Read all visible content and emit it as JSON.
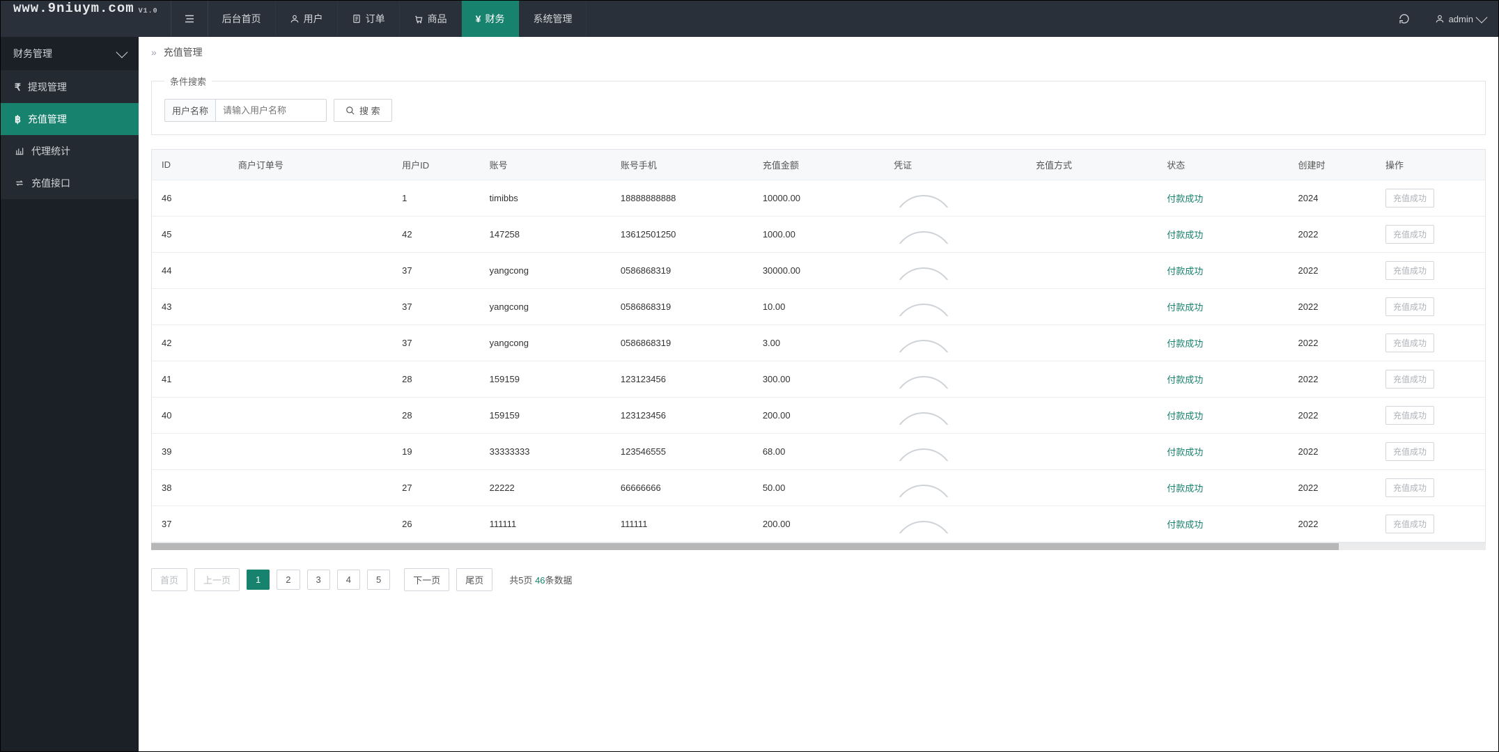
{
  "brand": {
    "url": "www.9niuym.com",
    "version": "V1.0"
  },
  "topnav": {
    "items": [
      {
        "key": "home",
        "label": "后台首页"
      },
      {
        "key": "user",
        "label": "用户"
      },
      {
        "key": "order",
        "label": "订单"
      },
      {
        "key": "product",
        "label": "商品"
      },
      {
        "key": "finance",
        "label": "财务"
      },
      {
        "key": "system",
        "label": "系统管理"
      }
    ],
    "active": "finance"
  },
  "user": {
    "name": "admin"
  },
  "sidebar": {
    "group": "财务管理",
    "items": [
      {
        "key": "withdraw",
        "label": "提现管理"
      },
      {
        "key": "recharge",
        "label": "充值管理"
      },
      {
        "key": "agent",
        "label": "代理统计"
      },
      {
        "key": "gateway",
        "label": "充值接口"
      }
    ],
    "active": "recharge"
  },
  "breadcrumb": {
    "title": "充值管理"
  },
  "search": {
    "legend": "条件搜索",
    "field_label": "用户名称",
    "placeholder": "请输入用户名称",
    "button": "搜 索"
  },
  "table": {
    "columns": {
      "id": "ID",
      "merchant_order": "商户订单号",
      "user_id": "用户ID",
      "account": "账号",
      "phone": "账号手机",
      "amount": "充值金额",
      "proof": "凭证",
      "method": "充值方式",
      "status": "状态",
      "created": "创建时",
      "op": "操作"
    },
    "status_ok_label": "付款成功",
    "op_button_label": "充值成功",
    "rows": [
      {
        "id": "46",
        "merchant_order": "",
        "user_id": "1",
        "account": "timibbs",
        "phone": "18888888888",
        "amount": "10000.00",
        "method": "",
        "status": "付款成功",
        "created": "2024"
      },
      {
        "id": "45",
        "merchant_order": "",
        "user_id": "42",
        "account": "147258",
        "phone": "13612501250",
        "amount": "1000.00",
        "method": "",
        "status": "付款成功",
        "created": "2022"
      },
      {
        "id": "44",
        "merchant_order": "",
        "user_id": "37",
        "account": "yangcong",
        "phone": "0586868319",
        "amount": "30000.00",
        "method": "",
        "status": "付款成功",
        "created": "2022"
      },
      {
        "id": "43",
        "merchant_order": "",
        "user_id": "37",
        "account": "yangcong",
        "phone": "0586868319",
        "amount": "10.00",
        "method": "",
        "status": "付款成功",
        "created": "2022"
      },
      {
        "id": "42",
        "merchant_order": "",
        "user_id": "37",
        "account": "yangcong",
        "phone": "0586868319",
        "amount": "3.00",
        "method": "",
        "status": "付款成功",
        "created": "2022"
      },
      {
        "id": "41",
        "merchant_order": "",
        "user_id": "28",
        "account": "159159",
        "phone": "123123456",
        "amount": "300.00",
        "method": "",
        "status": "付款成功",
        "created": "2022"
      },
      {
        "id": "40",
        "merchant_order": "",
        "user_id": "28",
        "account": "159159",
        "phone": "123123456",
        "amount": "200.00",
        "method": "",
        "status": "付款成功",
        "created": "2022"
      },
      {
        "id": "39",
        "merchant_order": "",
        "user_id": "19",
        "account": "33333333",
        "phone": "123546555",
        "amount": "68.00",
        "method": "",
        "status": "付款成功",
        "created": "2022"
      },
      {
        "id": "38",
        "merchant_order": "",
        "user_id": "27",
        "account": "22222",
        "phone": "66666666",
        "amount": "50.00",
        "method": "",
        "status": "付款成功",
        "created": "2022"
      },
      {
        "id": "37",
        "merchant_order": "",
        "user_id": "26",
        "account": "111111",
        "phone": "111111",
        "amount": "200.00",
        "method": "",
        "status": "付款成功",
        "created": "2022"
      }
    ]
  },
  "pagination": {
    "first": "首页",
    "prev": "上一页",
    "next": "下一页",
    "last": "尾页",
    "pages": [
      "1",
      "2",
      "3",
      "4",
      "5"
    ],
    "active": "1",
    "info_prefix": "共5页 ",
    "total": "46",
    "info_suffix": "条数据"
  },
  "icons": {
    "user": "user-icon",
    "order": "file-icon",
    "product": "cart-icon",
    "finance": "yen-icon",
    "refresh": "refresh-icon",
    "person": "person-icon",
    "search": "search-icon",
    "withdraw": "rupee-icon",
    "recharge": "bitcoin-icon",
    "agent": "chart-icon",
    "gateway": "swap-icon"
  }
}
